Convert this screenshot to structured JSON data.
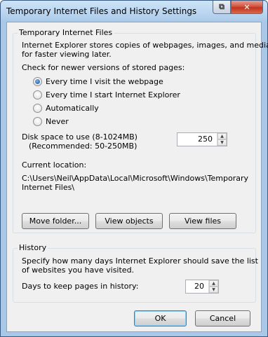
{
  "window": {
    "title": "Temporary Internet Files and History Settings",
    "help_glyph": "⧉",
    "close_glyph": "✕"
  },
  "temp_files": {
    "legend": "Temporary Internet Files",
    "description_line1": "Internet Explorer stores copies of webpages, images, and media",
    "description_line2": "for faster viewing later.",
    "check_label": "Check for newer versions of stored pages:",
    "options": [
      {
        "label": "Every time I visit the webpage",
        "selected": true
      },
      {
        "label": "Every time I start Internet Explorer",
        "selected": false
      },
      {
        "label": "Automatically",
        "selected": false
      },
      {
        "label": "Never",
        "selected": false
      }
    ],
    "disk_label_line1": "Disk space to use (8-1024MB)",
    "disk_label_line2": "(Recommended: 50-250MB)",
    "disk_value": "250",
    "current_location_label": "Current location:",
    "location_line1": "C:\\Users\\Neil\\AppData\\Local\\Microsoft\\Windows\\Temporary",
    "location_line2": "Internet Files\\",
    "move_folder": "Move folder...",
    "view_objects": "View objects",
    "view_files": "View files"
  },
  "history": {
    "legend": "History",
    "description_line1": "Specify how many days Internet Explorer should save the list",
    "description_line2": "of websites you have visited.",
    "days_label": "Days to keep pages in history:",
    "days_value": "20"
  },
  "footer": {
    "ok": "OK",
    "cancel": "Cancel"
  }
}
